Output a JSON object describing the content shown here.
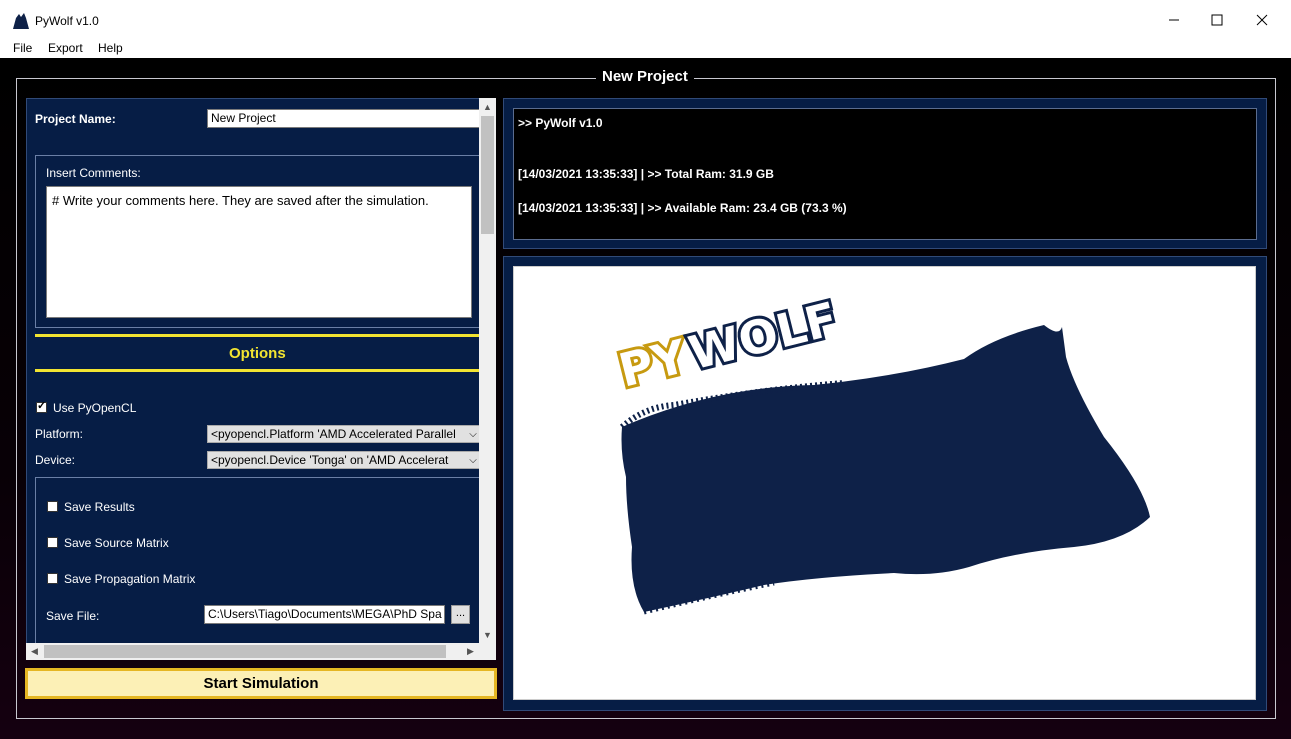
{
  "window": {
    "title": "PyWolf v1.0",
    "icon": "wolf-icon",
    "controls": [
      "minimize-icon",
      "maximize-icon",
      "close-icon"
    ]
  },
  "menu": [
    "File",
    "Export",
    "Help"
  ],
  "frame_title": "New Project",
  "left_panel": {
    "project_name_label": "Project Name:",
    "project_name_value": "New Project",
    "comments_label": "Insert Comments:",
    "comments_value": "# Write your comments here. They are saved after the simulation.",
    "options_title": "Options",
    "use_pyopencl_label": "Use PyOpenCL",
    "use_pyopencl_checked": true,
    "platform_label": "Platform:",
    "platform_value": "<pyopencl.Platform 'AMD Accelerated Parallel",
    "device_label": "Device:",
    "device_value": "<pyopencl.Device 'Tonga' on 'AMD Accelerat",
    "save_results_label": "Save Results",
    "save_source_label": "Save Source Matrix",
    "save_propagation_label": "Save Propagation Matrix",
    "save_file_label": "Save File:",
    "save_file_value": "C:\\Users\\Tiago\\Documents\\MEGA\\PhD Spa",
    "browse_label": "..."
  },
  "start_button_label": "Start Simulation",
  "console": {
    "lines": [
      ">> PyWolf v1.0",
      "[14/03/2021 13:35:33]  | >> Total Ram: 31.9 GB",
      "[14/03/2021 13:35:33]  | >> Available Ram: 23.4 GB (73.3 %)"
    ]
  },
  "logo": {
    "text_py": "PY",
    "text_wolf": "WOLF"
  },
  "colors": {
    "panel_bg": "#061d45",
    "accent_yellow": "#f2e431",
    "button_bg": "#fcf0b6",
    "button_border": "#e5b623",
    "wolf_navy": "#0e2148"
  }
}
